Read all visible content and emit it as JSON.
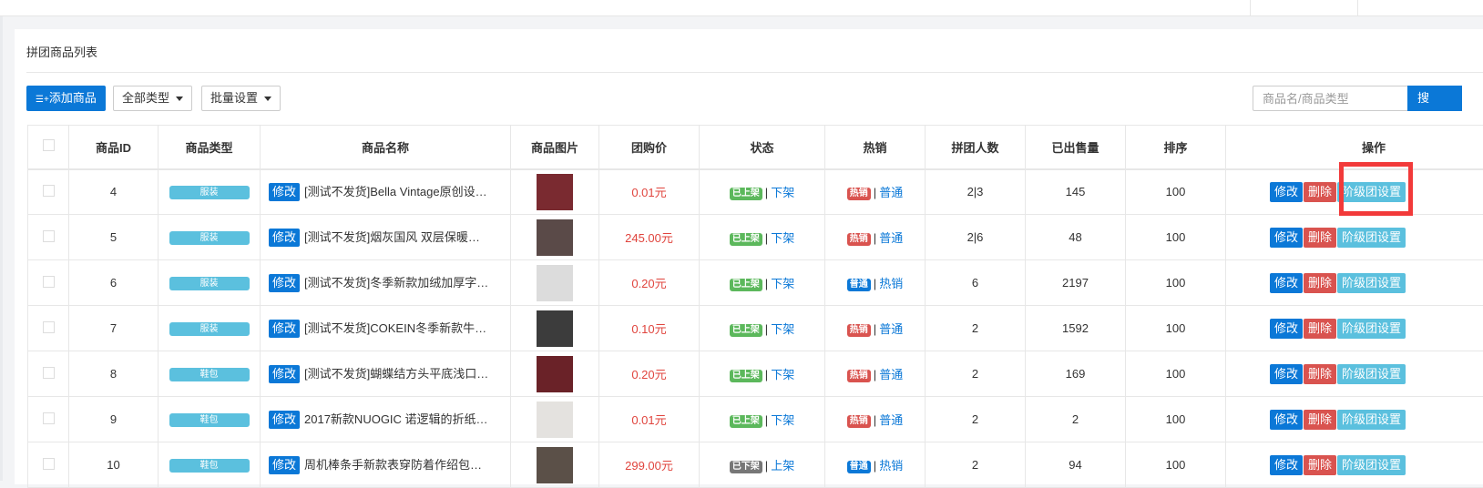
{
  "panel_title": "拼团商品列表",
  "toolbar": {
    "add_label": "添加商品",
    "type_filter": "全部类型",
    "batch_label": "批量设置",
    "search_placeholder": "商品名/商品类型",
    "search_button": "搜"
  },
  "table": {
    "headers": [
      "商品ID",
      "商品类型",
      "商品名称",
      "商品图片",
      "团购价",
      "状态",
      "热销",
      "拼团人数",
      "已出售量",
      "排序",
      "操作"
    ],
    "edit_tag": "修改",
    "ops": {
      "edit": "修改",
      "delete": "删除",
      "tier": "阶级团设置"
    },
    "rows": [
      {
        "id": "4",
        "type": "服装",
        "name": "[测试不发货]Bella Vintage原创设…",
        "thumb": "#7a2a30",
        "price": "0.01元",
        "status": "已上架",
        "status_color": "green",
        "status_action": "下架",
        "hot": "热销",
        "hot_color": "red",
        "hot_action": "普通",
        "people": "2|3",
        "sold": "145",
        "sort": "100"
      },
      {
        "id": "5",
        "type": "服装",
        "name": "[测试不发货]烟灰国风 双层保暖…",
        "thumb": "#5a4a48",
        "price": "245.00元",
        "status": "已上架",
        "status_color": "green",
        "status_action": "下架",
        "hot": "热销",
        "hot_color": "red",
        "hot_action": "普通",
        "people": "2|6",
        "sold": "48",
        "sort": "100"
      },
      {
        "id": "6",
        "type": "服装",
        "name": "[测试不发货]冬季新款加绒加厚字…",
        "thumb": "#dcdcdc",
        "price": "0.20元",
        "status": "已上架",
        "status_color": "green",
        "status_action": "下架",
        "hot": "普通",
        "hot_color": "blue",
        "hot_action": "热销",
        "people": "6",
        "sold": "2197",
        "sort": "100"
      },
      {
        "id": "7",
        "type": "服装",
        "name": "[测试不发货]COKEIN冬季新款牛…",
        "thumb": "#3c3c3c",
        "price": "0.10元",
        "status": "已上架",
        "status_color": "green",
        "status_action": "下架",
        "hot": "热销",
        "hot_color": "red",
        "hot_action": "普通",
        "people": "2",
        "sold": "1592",
        "sort": "100"
      },
      {
        "id": "8",
        "type": "鞋包",
        "name": "[测试不发货]蝴蝶结方头平底浅口…",
        "thumb": "#6a2228",
        "price": "0.20元",
        "status": "已上架",
        "status_color": "green",
        "status_action": "下架",
        "hot": "热销",
        "hot_color": "red",
        "hot_action": "普通",
        "people": "2",
        "sold": "169",
        "sort": "100"
      },
      {
        "id": "9",
        "type": "鞋包",
        "name": "2017新款NUOGIC 诺逻辑的折纸…",
        "thumb": "#e4e2df",
        "price": "0.01元",
        "status": "已上架",
        "status_color": "green",
        "status_action": "下架",
        "hot": "热销",
        "hot_color": "red",
        "hot_action": "普通",
        "people": "2",
        "sold": "2",
        "sort": "100"
      },
      {
        "id": "10",
        "type": "鞋包",
        "name": "周机棒条手新款表穿防着作绍包…",
        "thumb": "#5b5048",
        "price": "299.00元",
        "status": "已下架",
        "status_color": "grey",
        "status_action": "上架",
        "hot": "普通",
        "hot_color": "blue",
        "hot_action": "热销",
        "people": "2",
        "sold": "94",
        "sort": "100"
      }
    ]
  }
}
